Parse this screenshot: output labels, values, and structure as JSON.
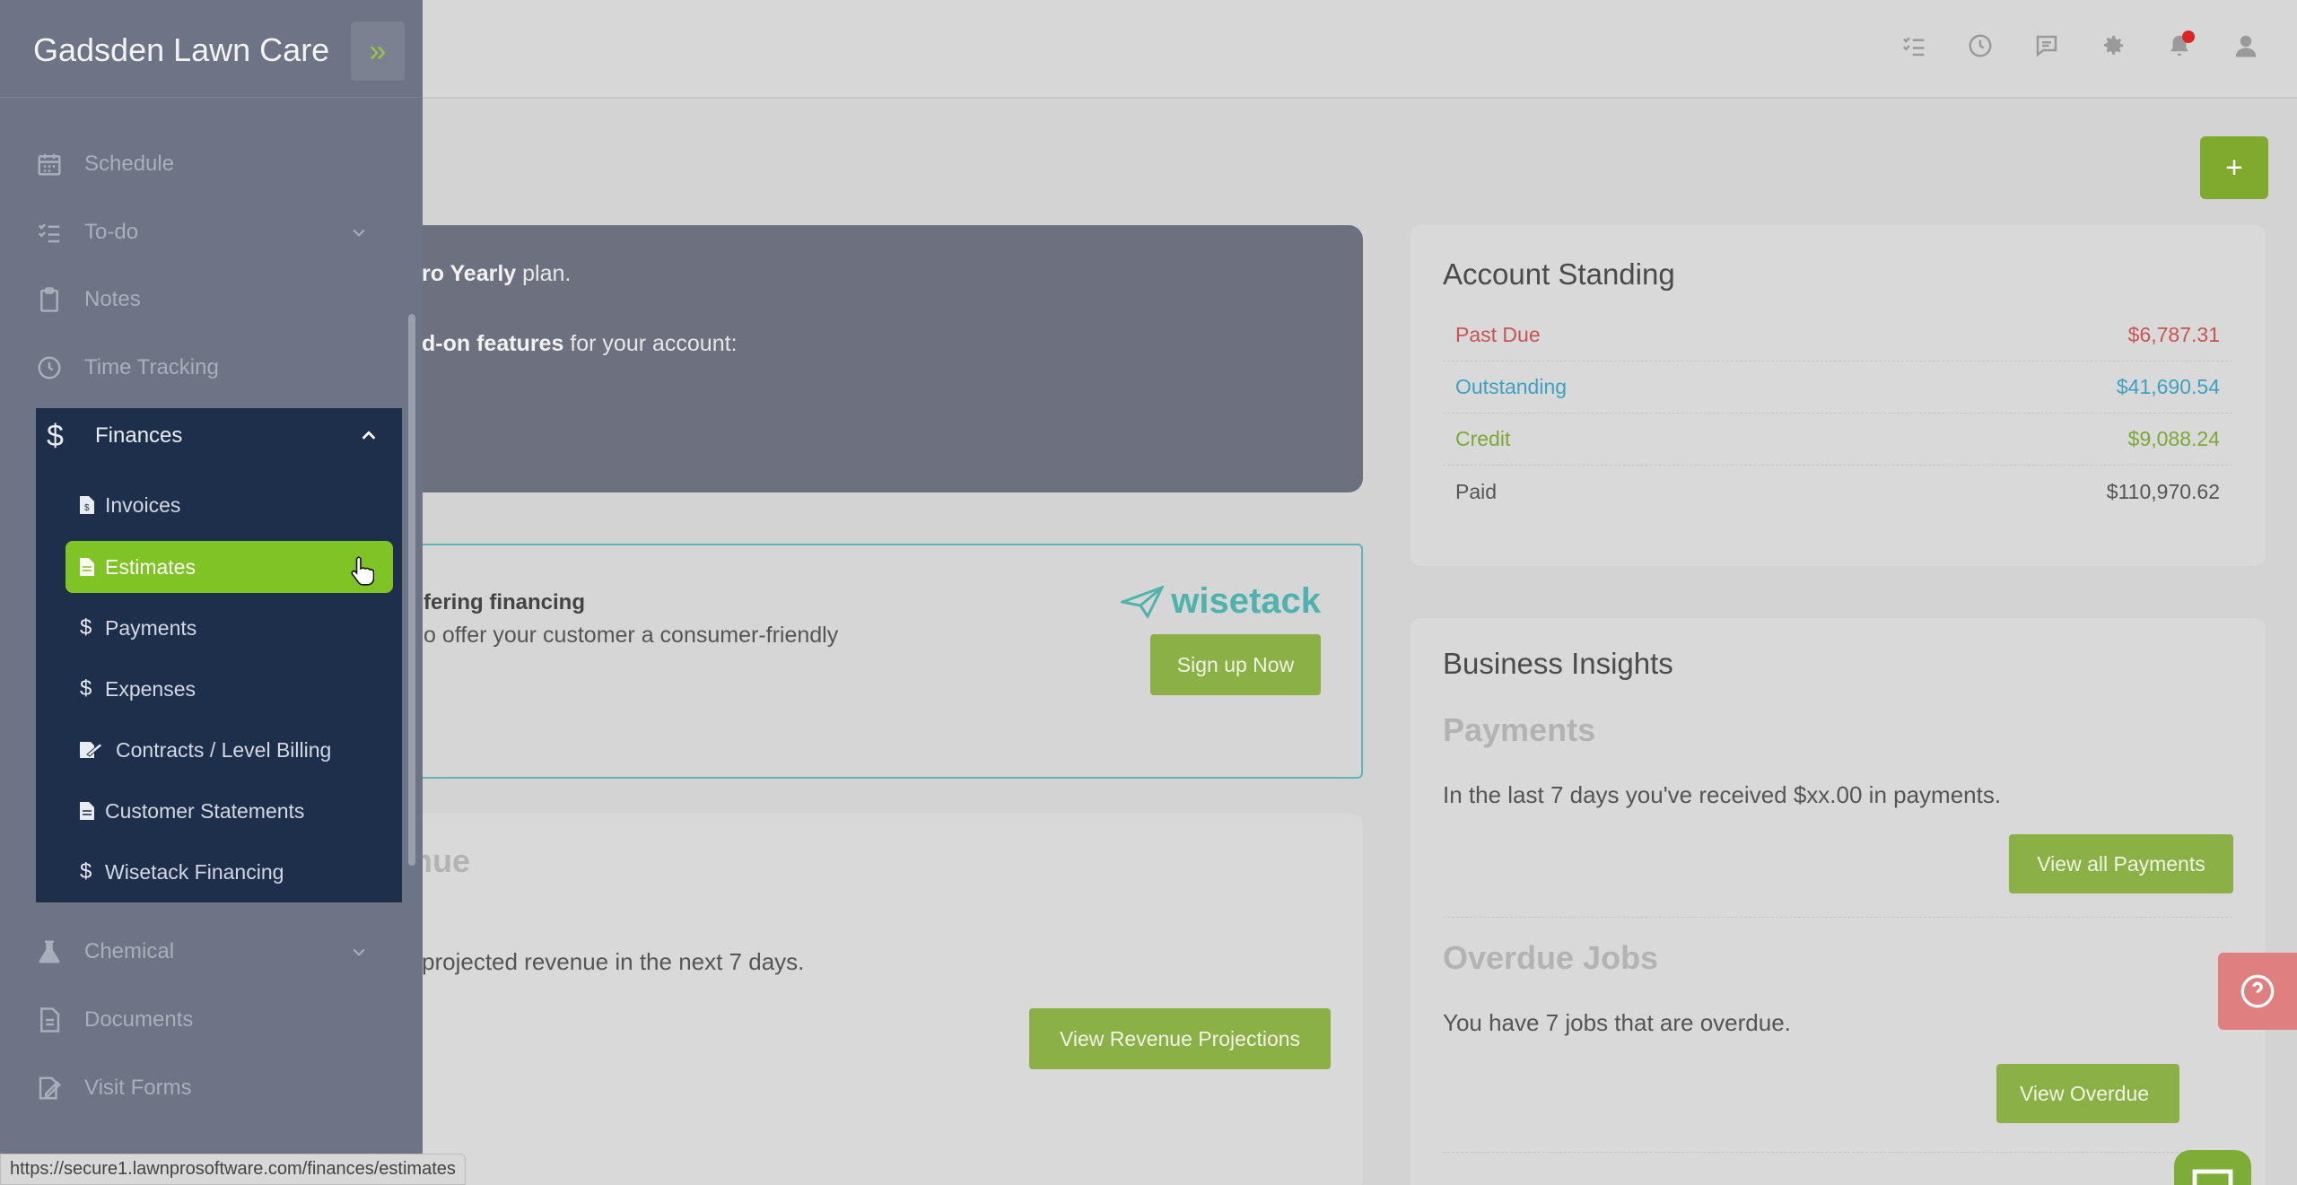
{
  "app": {
    "brand": "Gadsden Lawn Care",
    "status_url": "https://secure1.lawnprosoftware.com/finances/estimates"
  },
  "top_icons": [
    "checklist-icon",
    "clock-icon",
    "chat-icon",
    "gear-icon",
    "bell-icon",
    "user-icon"
  ],
  "sidebar": {
    "items": [
      {
        "label": "Schedule",
        "icon": "calendar-icon"
      },
      {
        "label": "To-do",
        "icon": "checklist-icon"
      },
      {
        "label": "Notes",
        "icon": "clipboard-icon"
      },
      {
        "label": "Time Tracking",
        "icon": "clock-icon"
      }
    ],
    "finances": {
      "label": "Finances",
      "sub": [
        {
          "label": "Invoices",
          "icon": "file-dollar-icon"
        },
        {
          "label": "Estimates",
          "icon": "file-icon"
        },
        {
          "label": "Payments",
          "icon": "dollar-icon"
        },
        {
          "label": "Expenses",
          "icon": "dollar-icon"
        },
        {
          "label": "Contracts / Level Billing",
          "icon": "file-sign-icon"
        },
        {
          "label": "Customer Statements",
          "icon": "file-icon"
        },
        {
          "label": "Wisetack Financing",
          "icon": "dollar-icon"
        }
      ]
    },
    "bottom": [
      {
        "label": "Chemical",
        "icon": "flask-icon"
      },
      {
        "label": "Documents",
        "icon": "document-icon"
      },
      {
        "label": "Visit Forms",
        "icon": "form-icon"
      }
    ]
  },
  "plan": {
    "line1_bold": "ro Yearly",
    "line1_rest": " plan.",
    "line2_bold": "d-on features",
    "line2_rest": " for your account:"
  },
  "wisetack": {
    "title": "fering financing",
    "desc": "o offer your customer a consumer-friendly",
    "logo": "wisetack",
    "button": "Sign up Now"
  },
  "revenue": {
    "title": "nue",
    "text": "projected revenue in the next 7 days.",
    "button": "View Revenue Projections"
  },
  "account": {
    "title": "Account Standing",
    "rows": [
      {
        "label": "Past Due",
        "value": "$6,787.31",
        "color": "#c95454"
      },
      {
        "label": "Outstanding",
        "value": "$41,690.54",
        "color": "#3ea1c2"
      },
      {
        "label": "Credit",
        "value": "$9,088.24",
        "color": "#7ea834"
      },
      {
        "label": "Paid",
        "value": "$110,970.62",
        "color": "#555555"
      }
    ]
  },
  "insights": {
    "title": "Business Insights",
    "payments_title": "Payments",
    "payments_text": "In the last 7 days you've received $xx.00 in payments.",
    "payments_button": "View all Payments",
    "overdue_title": "Overdue Jobs",
    "overdue_text": "You have 7 jobs that are overdue.",
    "overdue_button": "View Overdue"
  },
  "add_button": "+"
}
